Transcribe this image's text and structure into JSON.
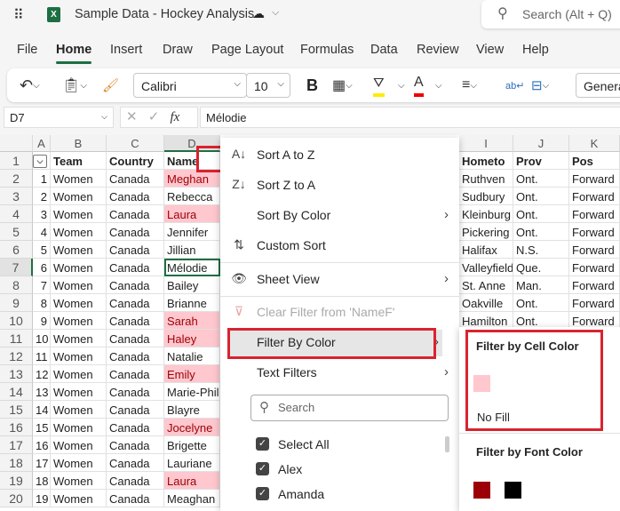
{
  "titlebar": {
    "title": "Sample Data - Hockey Analysis",
    "search_placeholder": "Search (Alt + Q)"
  },
  "tabs": [
    "File",
    "Home",
    "Insert",
    "Draw",
    "Page Layout",
    "Formulas",
    "Data",
    "Review",
    "View",
    "Help"
  ],
  "ribbon": {
    "font": "Calibri",
    "size": "10",
    "bold": "B",
    "number_format": "Genera"
  },
  "formula_bar": {
    "name_box": "D7",
    "fx": "fx",
    "value": "Mélodie"
  },
  "columns_left": [
    "A",
    "B",
    "C",
    "D"
  ],
  "columns_right": [
    "I",
    "J",
    "K"
  ],
  "headers": {
    "B": "Team",
    "C": "Country",
    "D": "Name",
    "I": "Hometo",
    "J": "Prov",
    "K": "Pos"
  },
  "rows": [
    {
      "n": "1",
      "a": "1",
      "b": "Women",
      "c": "Canada",
      "d": "Meghan",
      "pink": true,
      "i": "Ruthven",
      "j": "Ont.",
      "k": "Forward"
    },
    {
      "n": "2",
      "a": "2",
      "b": "Women",
      "c": "Canada",
      "d": "Rebecca",
      "pink": false,
      "i": "Sudbury",
      "j": "Ont.",
      "k": "Forward"
    },
    {
      "n": "3",
      "a": "3",
      "b": "Women",
      "c": "Canada",
      "d": "Laura",
      "pink": true,
      "i": "Kleinburg",
      "j": "Ont.",
      "k": "Forward"
    },
    {
      "n": "4",
      "a": "4",
      "b": "Women",
      "c": "Canada",
      "d": "Jennifer",
      "pink": false,
      "i": "Pickering",
      "j": "Ont.",
      "k": "Forward"
    },
    {
      "n": "5",
      "a": "5",
      "b": "Women",
      "c": "Canada",
      "d": "Jillian",
      "pink": false,
      "i": "Halifax",
      "j": "N.S.",
      "k": "Forward"
    },
    {
      "n": "6",
      "a": "6",
      "b": "Women",
      "c": "Canada",
      "d": "Mélodie",
      "pink": false,
      "i": "Valleyfield",
      "j": "Que.",
      "k": "Forward"
    },
    {
      "n": "7",
      "a": "7",
      "b": "Women",
      "c": "Canada",
      "d": "Bailey",
      "pink": false,
      "i": "St. Anne",
      "j": "Man.",
      "k": "Forward"
    },
    {
      "n": "8",
      "a": "8",
      "b": "Women",
      "c": "Canada",
      "d": "Brianne",
      "pink": false,
      "i": "Oakville",
      "j": "Ont.",
      "k": "Forward"
    },
    {
      "n": "9",
      "a": "9",
      "b": "Women",
      "c": "Canada",
      "d": "Sarah",
      "pink": true,
      "i": "Hamilton",
      "j": "Ont.",
      "k": "Forward"
    },
    {
      "n": "10",
      "a": "10",
      "b": "Women",
      "c": "Canada",
      "d": "Haley",
      "pink": true
    },
    {
      "n": "11",
      "a": "11",
      "b": "Women",
      "c": "Canada",
      "d": "Natalie",
      "pink": false
    },
    {
      "n": "12",
      "a": "12",
      "b": "Women",
      "c": "Canada",
      "d": "Emily",
      "pink": true
    },
    {
      "n": "13",
      "a": "13",
      "b": "Women",
      "c": "Canada",
      "d": "Marie-Philip",
      "pink": false
    },
    {
      "n": "14",
      "a": "14",
      "b": "Women",
      "c": "Canada",
      "d": "Blayre",
      "pink": false
    },
    {
      "n": "15",
      "a": "15",
      "b": "Women",
      "c": "Canada",
      "d": "Jocelyne",
      "pink": true
    },
    {
      "n": "16",
      "a": "16",
      "b": "Women",
      "c": "Canada",
      "d": "Brigette",
      "pink": false
    },
    {
      "n": "17",
      "a": "17",
      "b": "Women",
      "c": "Canada",
      "d": "Lauriane",
      "pink": false
    },
    {
      "n": "18",
      "a": "18",
      "b": "Women",
      "c": "Canada",
      "d": "Laura",
      "pink": true
    },
    {
      "n": "19",
      "a": "19",
      "b": "Women",
      "c": "Canada",
      "d": "Meaghan",
      "pink": false
    }
  ],
  "row_numbers": [
    "1",
    "2",
    "3",
    "4",
    "5",
    "6",
    "7",
    "8",
    "9",
    "10",
    "11",
    "12",
    "13",
    "14",
    "15",
    "16",
    "17",
    "18",
    "19",
    "20"
  ],
  "menu": {
    "sort_az": "Sort A to Z",
    "sort_za": "Sort Z to A",
    "sort_by_color": "Sort By Color",
    "custom_sort": "Custom Sort",
    "sheet_view": "Sheet View",
    "clear_filter": "Clear Filter from 'NameF'",
    "filter_by_color": "Filter By Color",
    "text_filters": "Text Filters",
    "search_placeholder": "Search",
    "values": [
      "Select All",
      "Alex",
      "Amanda"
    ]
  },
  "submenu": {
    "cell_color_title": "Filter by Cell Color",
    "no_fill": "No Fill",
    "font_color_title": "Filter by Font Color",
    "cell_colors": [
      "#ffc7ce"
    ],
    "font_colors": [
      "#9c0006",
      "#000000"
    ]
  }
}
